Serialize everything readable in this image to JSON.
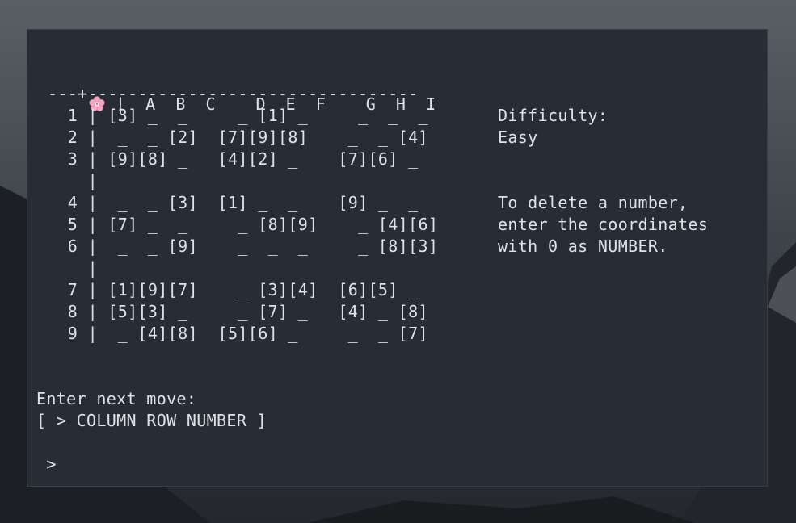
{
  "terminal": {
    "header": {
      "icon": "cherry-blossom-icon",
      "columns_text": " |  A  B  C    D  E  F    G  H  I",
      "separator": "---+---------------------------------"
    },
    "board_rows": [
      "  1 | [3] _  _     _ [1] _     _  _  _",
      "  2 |  _  _ [2]  [7][9][8]    _  _ [4]",
      "  3 | [9][8] _   [4][2] _    [7][6] _",
      "    |",
      "  4 |  _  _ [3]  [1] _  _    [9] _  _",
      "  5 | [7] _  _     _ [8][9]    _ [4][6]",
      "  6 |  _  _ [9]    _  _  _     _ [8][3]",
      "    |",
      "  7 | [1][9][7]    _ [3][4]  [6][5] _",
      "  8 | [5][3] _     _ [7] _   [4] _ [8]",
      "  9 |  _ [4][8]  [5][6] _     _  _ [7]"
    ],
    "side_panel": {
      "difficulty_label": "Difficulty:",
      "difficulty_value": "Easy",
      "help_line_1": "To delete a number,",
      "help_line_2": "enter the coordinates",
      "help_line_3": "with 0 as NUMBER."
    },
    "prompt": {
      "instruction": "Enter next move:",
      "format": "[ > COLUMN ROW NUMBER ]",
      "input_prompt": " >"
    }
  },
  "colors": {
    "terminal_bg": "#282c34",
    "text": "#dfe3e8",
    "flower": "#f4a7c4"
  }
}
